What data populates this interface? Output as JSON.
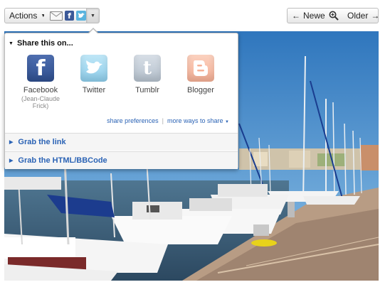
{
  "toolbar": {
    "actions_label": "Actions",
    "share_icons": [
      "email-icon",
      "facebook-icon",
      "twitter-icon"
    ],
    "newer_label": "Newer",
    "older_label": "Older",
    "zoom_icon": "magnifier-icon"
  },
  "share": {
    "heading": "Share this on...",
    "services": [
      {
        "name": "Facebook",
        "sub": "(Jean-Claude Frick)",
        "icon": "facebook-icon",
        "color": "#3b5998"
      },
      {
        "name": "Twitter",
        "sub": "",
        "icon": "twitter-icon",
        "color": "#8fcfed"
      },
      {
        "name": "Tumblr",
        "sub": "",
        "icon": "tumblr-icon",
        "color": "#b6c2ce"
      },
      {
        "name": "Blogger",
        "sub": "",
        "icon": "blogger-icon",
        "color": "#f6b096"
      }
    ],
    "share_preferences": "share preferences",
    "separator": "|",
    "more_ways": "more ways to share",
    "grab_link": "Grab the link",
    "grab_html": "Grab the HTML/BBCode"
  },
  "colors": {
    "link": "#2b63b5",
    "sky": "#3d84c7",
    "water": "#3b5d78"
  }
}
